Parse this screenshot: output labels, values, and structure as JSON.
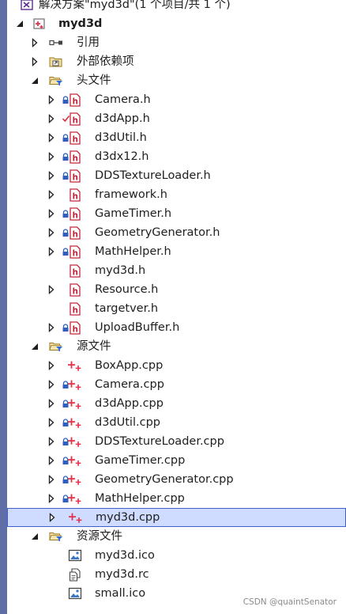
{
  "solution": {
    "label": "解决方案\"myd3d\"(1 个项目/共 1 个)"
  },
  "watermark": "CSDN @quaintSenator",
  "colors": {
    "header_red": "#c2263c",
    "cpp_red": "#e2314a",
    "lock_blue": "#2f5fbf",
    "check_red": "#d9303e",
    "selection": "#cfdcff",
    "selection_border": "#3e5fcc"
  },
  "tree": [
    {
      "label": "myd3d",
      "level": 0,
      "expander": "expanded",
      "icon": "project-icon",
      "bold": true
    },
    {
      "label": "引用",
      "level": 1,
      "expander": "collapsed",
      "icon": "references-icon"
    },
    {
      "label": "外部依赖项",
      "level": 1,
      "expander": "collapsed",
      "icon": "external-dependencies-icon"
    },
    {
      "label": "头文件",
      "level": 1,
      "expander": "expanded",
      "icon": "folder-filter-icon"
    },
    {
      "label": "Camera.h",
      "level": 2,
      "expander": "collapsed",
      "status": "lock",
      "icon": "header-file-icon"
    },
    {
      "label": "d3dApp.h",
      "level": 2,
      "expander": "collapsed",
      "status": "check",
      "icon": "header-file-icon"
    },
    {
      "label": "d3dUtil.h",
      "level": 2,
      "expander": "collapsed",
      "status": "lock",
      "icon": "header-file-icon"
    },
    {
      "label": "d3dx12.h",
      "level": 2,
      "expander": "collapsed",
      "status": "lock",
      "icon": "header-file-icon"
    },
    {
      "label": "DDSTextureLoader.h",
      "level": 2,
      "expander": "collapsed",
      "status": "lock",
      "icon": "header-file-icon"
    },
    {
      "label": "framework.h",
      "level": 2,
      "expander": "collapsed",
      "status": "",
      "icon": "header-file-icon"
    },
    {
      "label": "GameTimer.h",
      "level": 2,
      "expander": "collapsed",
      "status": "lock",
      "icon": "header-file-icon"
    },
    {
      "label": "GeometryGenerator.h",
      "level": 2,
      "expander": "collapsed",
      "status": "lock",
      "icon": "header-file-icon"
    },
    {
      "label": "MathHelper.h",
      "level": 2,
      "expander": "collapsed",
      "status": "lock",
      "icon": "header-file-icon"
    },
    {
      "label": "myd3d.h",
      "level": 2,
      "expander": "none",
      "status": "",
      "icon": "header-file-icon"
    },
    {
      "label": "Resource.h",
      "level": 2,
      "expander": "collapsed",
      "status": "",
      "icon": "header-file-icon"
    },
    {
      "label": "targetver.h",
      "level": 2,
      "expander": "none",
      "status": "",
      "icon": "header-file-icon"
    },
    {
      "label": "UploadBuffer.h",
      "level": 2,
      "expander": "collapsed",
      "status": "lock",
      "icon": "header-file-icon"
    },
    {
      "label": "源文件",
      "level": 1,
      "expander": "expanded",
      "icon": "folder-filter-icon"
    },
    {
      "label": "BoxApp.cpp",
      "level": 2,
      "expander": "collapsed",
      "status": "",
      "icon": "cpp-file-icon"
    },
    {
      "label": "Camera.cpp",
      "level": 2,
      "expander": "collapsed",
      "status": "lock",
      "icon": "cpp-file-icon"
    },
    {
      "label": "d3dApp.cpp",
      "level": 2,
      "expander": "collapsed",
      "status": "lock",
      "icon": "cpp-file-icon"
    },
    {
      "label": "d3dUtil.cpp",
      "level": 2,
      "expander": "collapsed",
      "status": "lock",
      "icon": "cpp-file-icon"
    },
    {
      "label": "DDSTextureLoader.cpp",
      "level": 2,
      "expander": "collapsed",
      "status": "lock",
      "icon": "cpp-file-icon"
    },
    {
      "label": "GameTimer.cpp",
      "level": 2,
      "expander": "collapsed",
      "status": "lock",
      "icon": "cpp-file-icon"
    },
    {
      "label": "GeometryGenerator.cpp",
      "level": 2,
      "expander": "collapsed",
      "status": "lock",
      "icon": "cpp-file-icon"
    },
    {
      "label": "MathHelper.cpp",
      "level": 2,
      "expander": "collapsed",
      "status": "lock",
      "icon": "cpp-file-icon"
    },
    {
      "label": "myd3d.cpp",
      "level": 2,
      "expander": "collapsed",
      "status": "",
      "icon": "cpp-file-icon",
      "selected": true
    },
    {
      "label": "资源文件",
      "level": 1,
      "expander": "expanded",
      "icon": "folder-filter-icon"
    },
    {
      "label": "myd3d.ico",
      "level": 2,
      "expander": "none",
      "status": "",
      "icon": "image-file-icon"
    },
    {
      "label": "myd3d.rc",
      "level": 2,
      "expander": "none",
      "status": "",
      "icon": "resource-file-icon"
    },
    {
      "label": "small.ico",
      "level": 2,
      "expander": "none",
      "status": "",
      "icon": "image-file-icon"
    }
  ]
}
